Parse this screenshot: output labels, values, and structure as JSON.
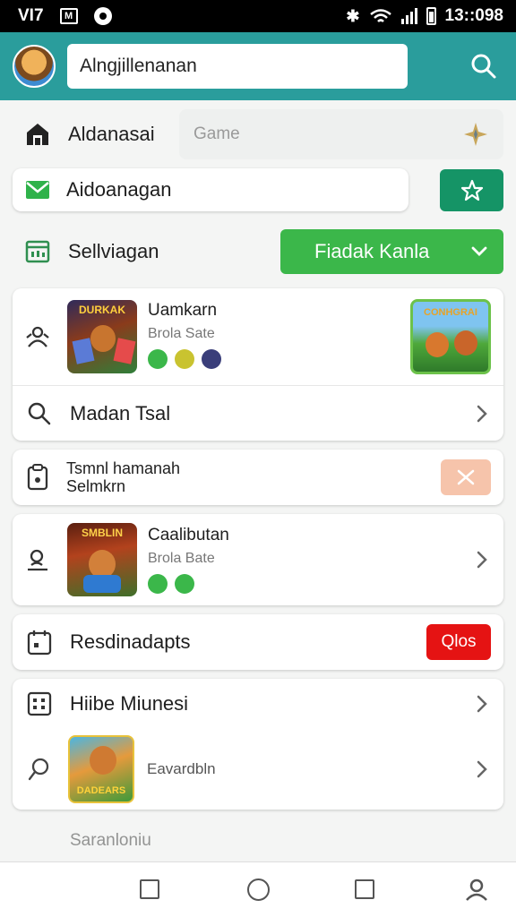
{
  "status_bar": {
    "carrier": "VI7",
    "clock": "13::098"
  },
  "header": {
    "search_value": "Alngjillenanan"
  },
  "top_row": {
    "label": "Aldanasai",
    "game_placeholder": "Game"
  },
  "mail_row": {
    "label": "Aidoanagan"
  },
  "select_row": {
    "label": "Sellviagan",
    "dropdown_value": "Fiadak Kanla"
  },
  "game_card_1": {
    "title": "Uamkarn",
    "subtitle": "Brola Sate",
    "thumb_text": "DURKAK",
    "promo_text": "CONHGRAI",
    "link_label": "Madan Tsal"
  },
  "twoline_row": {
    "line1": "Tsmnl hamanah",
    "line2": "Selmkrn"
  },
  "game_card_2": {
    "title": "Caalibutan",
    "subtitle": "Brola Bate",
    "thumb_text": "SMBLIN"
  },
  "reminder_row": {
    "label": "Resdinadapts",
    "badge": "Qlos"
  },
  "list_card": {
    "label": "Hiibe Miunesi",
    "item_label": "Eavardbln",
    "thumb_text": "DADEARS"
  },
  "faded_row": {
    "label": "Saranloniu"
  },
  "colors": {
    "header": "#2a9d9c",
    "green": "#3bb74a",
    "teal": "#159466",
    "red": "#e51313",
    "peach": "#f6c4ab"
  }
}
